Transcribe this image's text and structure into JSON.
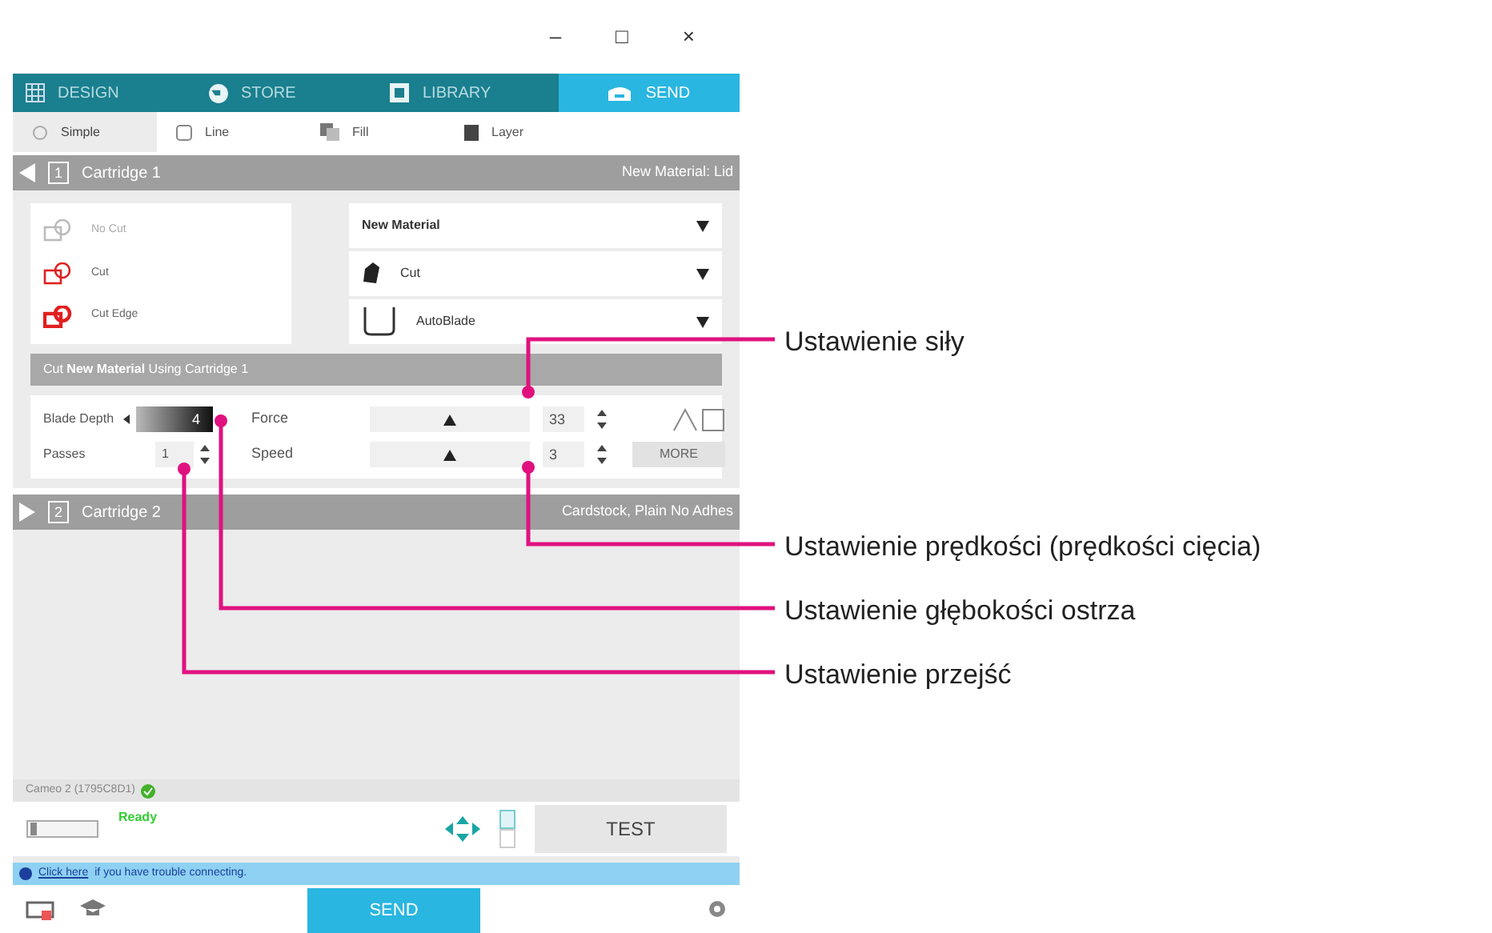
{
  "window": {
    "controls": [
      "–",
      "□",
      "×"
    ]
  },
  "tabs": [
    {
      "label": "DESIGN",
      "kind": "grid",
      "selected": false
    },
    {
      "label": "STORE",
      "kind": "store",
      "selected": false
    },
    {
      "label": "LIBRARY",
      "kind": "library",
      "selected": false
    },
    {
      "label": "SEND",
      "kind": "send",
      "selected": true
    }
  ],
  "modes": [
    {
      "label": "Simple",
      "kind": "simple",
      "selected": true
    },
    {
      "label": "Line",
      "kind": "line",
      "selected": false
    },
    {
      "label": "Fill",
      "kind": "fill",
      "selected": false
    },
    {
      "label": "Layer",
      "kind": "layer",
      "selected": false
    }
  ],
  "cartridge_1": {
    "number": "1",
    "title": "Cartridge 1",
    "expanded": true,
    "material": "New Material: Lid",
    "actions": [
      {
        "label": "No Cut",
        "kind": "no-cut"
      },
      {
        "label": "Cut",
        "kind": "cut"
      },
      {
        "label": "Cut Edge",
        "kind": "cut-edge"
      }
    ],
    "dropdowns": [
      {
        "label": "New Material",
        "kind": "material"
      },
      {
        "label": "Cut",
        "kind": "action"
      },
      {
        "label": "AutoBlade",
        "kind": "blade"
      }
    ],
    "summary": "Cut **New Material** Using Cartridge 1",
    "blade_depth": {
      "label": "Blade Depth",
      "value": "4"
    },
    "passes": {
      "label": "Passes",
      "value": "1"
    },
    "force": {
      "label": "Force",
      "value": "33",
      "level": 0.5
    },
    "speed": {
      "label": "Speed",
      "value": "3",
      "level": 0.5
    },
    "more_button": "MORE"
  },
  "cartridge_2": {
    "number": "2",
    "title": "Cartridge 2",
    "expanded": false,
    "material": "Cardstock, Plain No Adhes"
  },
  "device": {
    "name": "Cameo 2 (1795C8D1)",
    "status": "Ready",
    "test_button": "TEST"
  },
  "info_bar": {
    "link": "Click here",
    "text": "if you have trouble connecting."
  },
  "send_button": "SEND",
  "callouts": [
    {
      "label": "Ustawienie siły"
    },
    {
      "label": "Ustawienie prędkości (prędkości cięcia)"
    },
    {
      "label": "Ustawienie głębokości ostrza"
    },
    {
      "label": "Ustawienie przejść"
    }
  ]
}
